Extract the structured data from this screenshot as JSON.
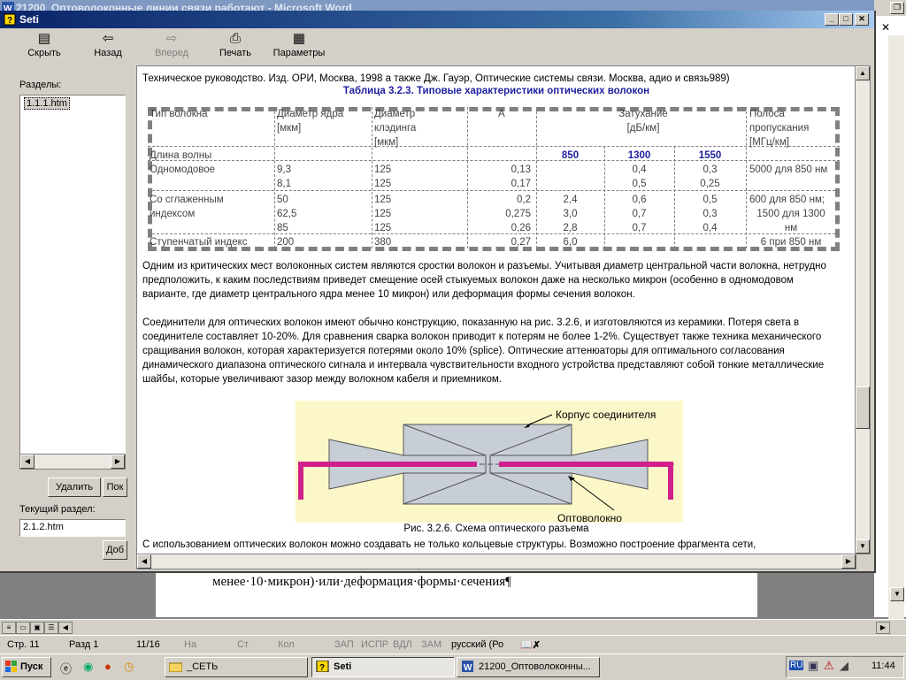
{
  "word": {
    "title": "21200_Оптоволоконные линии связи работают - Microsoft Word",
    "doc_line": "менее·10·микрон)·или·деформация·формы·сечения¶",
    "status": {
      "page": "Стр. 11",
      "section": "Разд 1",
      "pages": "11/16",
      "at": "На",
      "line": "Ст",
      "col": "Кол",
      "rec": "ЗАП",
      "trk": "ИСПР",
      "ext": "ВДЛ",
      "ovr": "ЗАМ",
      "lang": "русский (Ро"
    }
  },
  "help": {
    "title": "Seti",
    "toolbar": [
      {
        "label": "Скрыть",
        "icon": "hide-icon",
        "glyph": "▤",
        "enabled": true
      },
      {
        "label": "Назад",
        "icon": "back-arrow-icon",
        "glyph": "⇦",
        "enabled": true
      },
      {
        "label": "Вперед",
        "icon": "forward-arrow-icon",
        "glyph": "⇨",
        "enabled": false
      },
      {
        "label": "Печать",
        "icon": "printer-icon",
        "glyph": "⎙",
        "enabled": true
      },
      {
        "label": "Параметры",
        "icon": "options-icon",
        "glyph": "▦",
        "enabled": true
      }
    ],
    "nav": {
      "sections_label": "Разделы:",
      "items": [
        "1.1.1.htm"
      ],
      "delete_btn": "Удалить",
      "show_btn": "Пок",
      "current_label": "Текущий раздел:",
      "current_value": "2.1.2.htm",
      "add_btn": "Доб"
    },
    "content": {
      "ref_line": "Техническое руководство. Изд. ОРИ, Москва, 1998 а также Дж. Гауэр, Оптические системы связи. Москва, адио и связь989)",
      "table_title": "Таблица 3.2.3. Типовые характеристики оптических волокон",
      "table": {
        "headers": {
          "type": "Тип волокна",
          "core": [
            "Диаметр ядра",
            "[мкм]"
          ],
          "clad": [
            "Диаметр",
            "клэдинга",
            "[мкм]"
          ],
          "na": "A",
          "atten": [
            "Затухание",
            "[дБ/км]"
          ],
          "band": [
            "Полоса",
            "пропускания",
            "[МГц/км]"
          ]
        },
        "wavelength_label": "Длина волны",
        "wavelengths": [
          "850",
          "1300",
          "1550"
        ],
        "rows": [
          {
            "type": [
              "Одномодовое"
            ],
            "core": [
              "9,3",
              "8,1"
            ],
            "clad": [
              "125",
              "125"
            ],
            "na": [
              "0,13",
              "0,17"
            ],
            "w850": [
              "",
              ""
            ],
            "w1300": [
              "0,4",
              "0,5"
            ],
            "w1550": [
              "0,3",
              "0,25"
            ],
            "band": [
              "5000 для 850 нм"
            ]
          },
          {
            "type": [
              "Со сглаженным",
              "индексом"
            ],
            "core": [
              "50",
              "62,5",
              "85"
            ],
            "clad": [
              "125",
              "125",
              "125"
            ],
            "na": [
              "0,2",
              "0,275",
              "0,26"
            ],
            "w850": [
              "2,4",
              "3,0",
              "2,8"
            ],
            "w1300": [
              "0,6",
              "0,7",
              "0,7"
            ],
            "w1550": [
              "0,5",
              "0,3",
              "0,4"
            ],
            "band": [
              "600 для 850 нм;",
              "1500 для 1300",
              "нм"
            ]
          },
          {
            "type": [
              "Ступенчатый индекс"
            ],
            "core": [
              "200"
            ],
            "clad": [
              "380"
            ],
            "na": [
              "0,27"
            ],
            "w850": [
              "6,0"
            ],
            "w1300": [
              ""
            ],
            "w1550": [
              ""
            ],
            "band": [
              "6 при 850 нм"
            ]
          }
        ]
      },
      "para1": "Одним из критических мест волоконных систем являются сростки волокон и разъемы. Учитывая диаметр центральной части волокна, нетрудно предположить, к каким последствиям приведет смещение осей стыкуемых волокон даже на несколько микрон (особенно в одномодовом варианте, где диаметр центрального ядра менее 10 микрон) или деформация формы сечения волокон.",
      "para2": "Соединители для оптических волокон имеют обычно конструкцию, показанную на рис. 3.2.6, и изготовляются из керамики. Потеря света в соединителе составляет 10-20%. Для сравнения сварка волокон приводит к потерям не более 1-2%. Существует также техника механического сращивания волокон, которая характеризуется потерями около 10% (splice). Оптические аттенюаторы для оптимального согласования динамического диапазона оптического сигнала и интервала чувствительности входного устройства представляют собой тонкие металлические шайбы, которые увеличивают зазор между волокном кабеля и приемником.",
      "fig_label_housing": "Корпус соединителя",
      "fig_label_fiber": "Оптоволокно",
      "fig_caption": "Рис. 3.2.6. Схема оптического разъема",
      "para3": "С использованием оптических волокон можно создавать не только кольцевые структуры. Возможно построение фрагмента сети,"
    }
  },
  "taskbar": {
    "start": "Пуск",
    "tasks": [
      "_СЕТЬ",
      "Seti",
      "21200_Оптоволоконны..."
    ],
    "tray_lang": "RU",
    "clock": "11:44"
  },
  "colors": {
    "fiber": "#d0208c",
    "figure_bg": "#fbf7c8",
    "title_bar": "#0a246a",
    "table_blue": "#1f1fa0"
  }
}
